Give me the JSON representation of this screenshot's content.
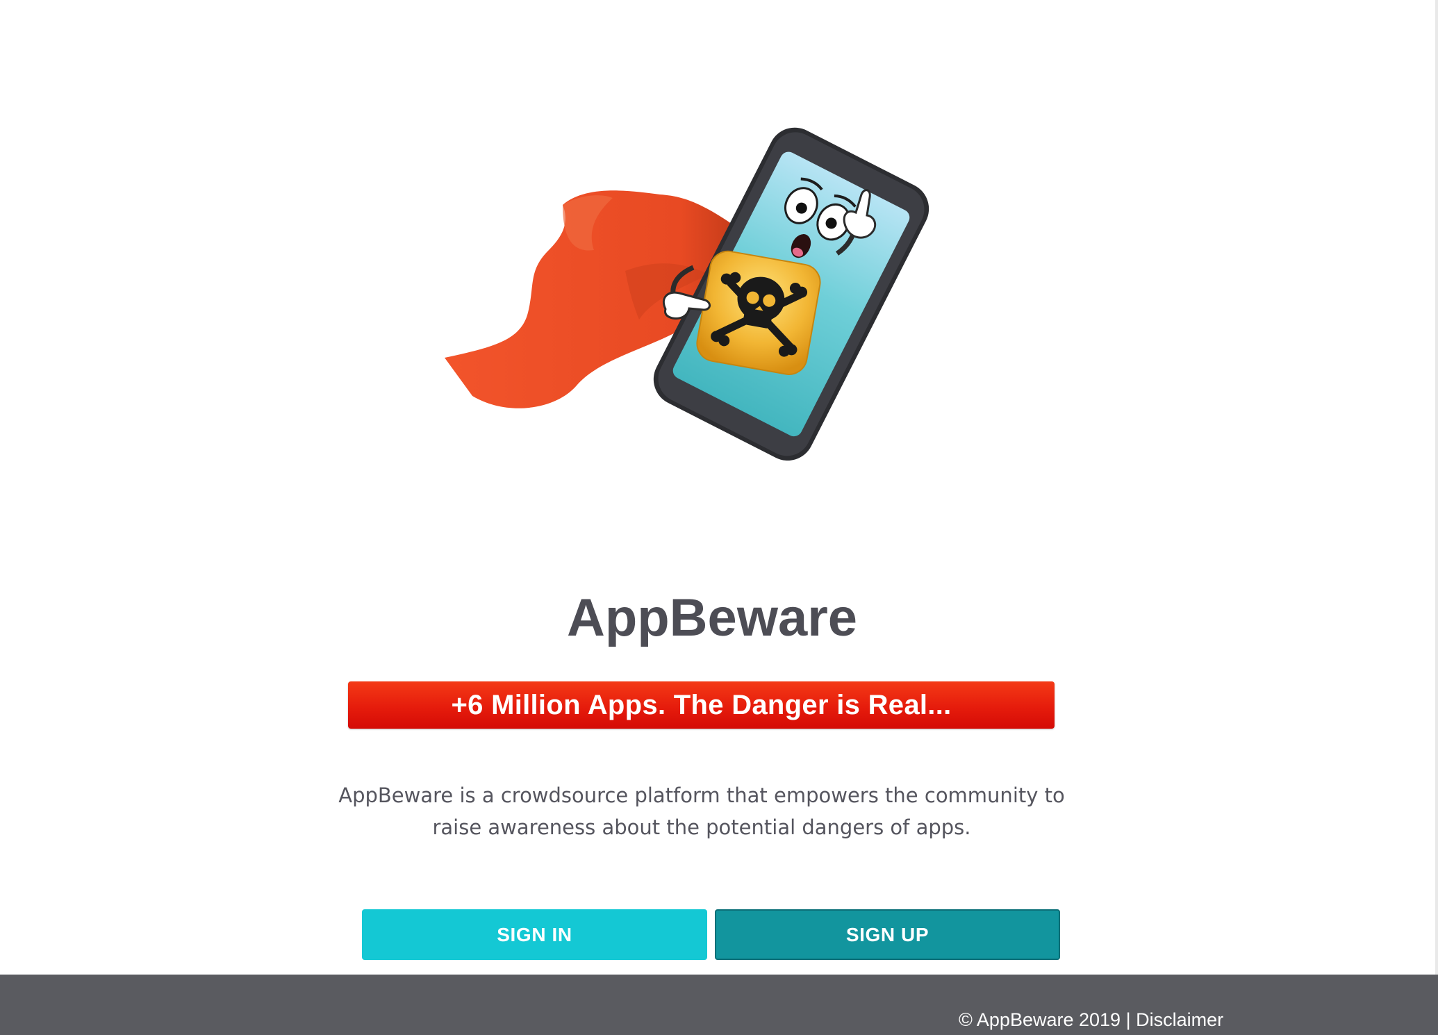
{
  "hero": {
    "illustration": "superhero-phone-with-skull-app-illustration",
    "icon_names": [
      "cape-icon",
      "smartphone-icon",
      "skull-crossbones-icon",
      "pointing-hand-icon"
    ]
  },
  "app": {
    "title": "AppBeware"
  },
  "banner": {
    "text": "+6 Million Apps. The Danger is Real...",
    "color_top": "#f43a16",
    "color_bottom": "#d40b06"
  },
  "description": {
    "line1": "AppBeware is a crowdsource platform that empowers the community to",
    "line2": "raise awareness about the potential dangers of apps."
  },
  "actions": {
    "sign_in_label": "SIGN IN",
    "sign_up_label": "SIGN UP",
    "sign_in_color": "#14c8d4",
    "sign_up_color": "#12959e"
  },
  "footer": {
    "copyright": "© AppBeware 2019",
    "separator": " | ",
    "disclaimer_label": "Disclaimer",
    "background": "#5a5b60"
  }
}
